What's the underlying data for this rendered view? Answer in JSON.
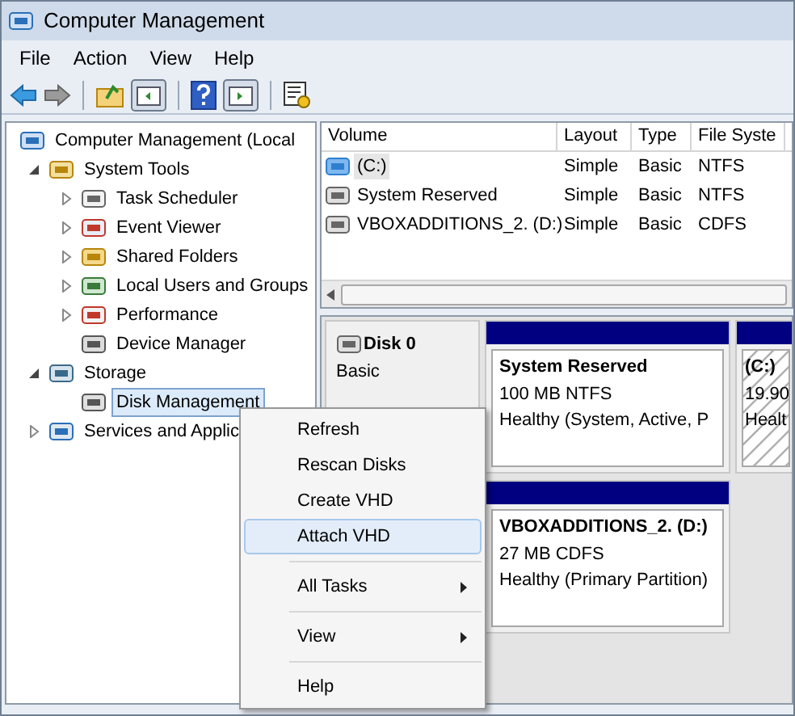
{
  "window": {
    "title": "Computer Management"
  },
  "menu_bar": [
    "File",
    "Action",
    "View",
    "Help"
  ],
  "tree": {
    "label": "Computer Management (Local",
    "children": [
      {
        "label": "System Tools",
        "expanded": true,
        "selected": false,
        "children": [
          {
            "label": "Task Scheduler",
            "expanded": false,
            "selected": false
          },
          {
            "label": "Event Viewer",
            "expanded": false,
            "selected": false
          },
          {
            "label": "Shared Folders",
            "expanded": false,
            "selected": false
          },
          {
            "label": "Local Users and Groups",
            "expanded": false,
            "selected": false
          },
          {
            "label": "Performance",
            "expanded": false,
            "selected": false
          },
          {
            "label": "Device Manager",
            "selected": false
          }
        ]
      },
      {
        "label": "Storage",
        "expanded": true,
        "selected": false,
        "children": [
          {
            "label": "Disk Management",
            "selected": true
          }
        ]
      },
      {
        "label": "Services and Applic",
        "expanded": false,
        "selected": false
      }
    ]
  },
  "volume_table": {
    "columns": [
      "Volume",
      "Layout",
      "Type",
      "File Syste"
    ],
    "rows": [
      {
        "cells": [
          "(C:)",
          "Simple",
          "Basic",
          "NTFS"
        ],
        "selected": true
      },
      {
        "cells": [
          "System Reserved",
          "Simple",
          "Basic",
          "NTFS"
        ],
        "selected": false
      },
      {
        "cells": [
          "VBOXADDITIONS_2. (D:)",
          "Simple",
          "Basic",
          "CDFS"
        ],
        "selected": false
      }
    ]
  },
  "disks": [
    {
      "label": "Disk 0",
      "lines": [
        "Basic"
      ],
      "partitions": [
        {
          "kind": "primary",
          "title": "System Reserved",
          "lines": [
            "100 MB NTFS",
            "Healthy (System, Active, P"
          ]
        },
        {
          "kind": "hatched",
          "title": "(C:)",
          "lines": [
            "19.90",
            "Healt"
          ]
        }
      ]
    },
    {
      "partitions": [
        {
          "kind": "primary",
          "title": "VBOXADDITIONS_2.  (D:)",
          "lines": [
            "27 MB CDFS",
            "Healthy (Primary Partition)"
          ]
        }
      ]
    }
  ],
  "context_menu": [
    {
      "kind": "item",
      "label": "Refresh",
      "selected": false
    },
    {
      "kind": "item",
      "label": "Rescan Disks",
      "selected": false
    },
    {
      "kind": "item",
      "label": "Create VHD",
      "selected": false
    },
    {
      "kind": "item",
      "label": "Attach VHD",
      "selected": true
    },
    {
      "kind": "separator"
    },
    {
      "kind": "item",
      "label": "All Tasks",
      "selected": false,
      "submenu": true
    },
    {
      "kind": "separator"
    },
    {
      "kind": "item",
      "label": "View",
      "selected": false,
      "submenu": true
    },
    {
      "kind": "separator"
    },
    {
      "kind": "item",
      "label": "Help",
      "selected": false
    }
  ]
}
